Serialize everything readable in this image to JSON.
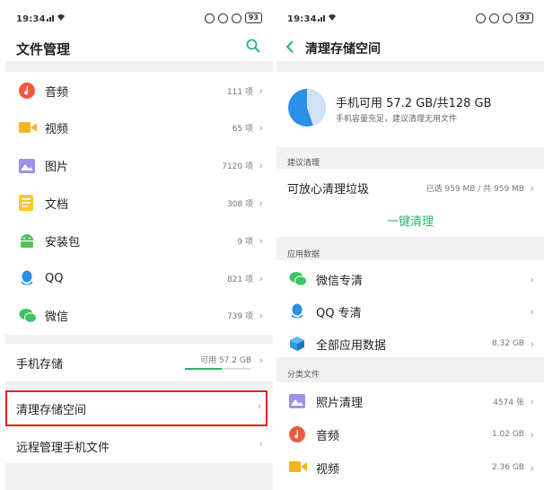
{
  "left": {
    "status_time": "19:34",
    "battery": "93",
    "title": "文件管理",
    "categories": [
      {
        "label": "音频",
        "count": "111 项",
        "color": "#f05a3c",
        "icon": "music-icon"
      },
      {
        "label": "视频",
        "count": "65 项",
        "color": "#f7b51c",
        "icon": "video-icon"
      },
      {
        "label": "图片",
        "count": "7120 项",
        "color": "#9f8fe8",
        "icon": "image-icon"
      },
      {
        "label": "文档",
        "count": "308 项",
        "color": "#f7c92e",
        "icon": "document-icon"
      },
      {
        "label": "安装包",
        "count": "9 项",
        "color": "#5bbf5b",
        "icon": "android-icon"
      },
      {
        "label": "QQ",
        "count": "821 项",
        "color": "#2c8fe8",
        "icon": "qq-icon"
      },
      {
        "label": "微信",
        "count": "739 项",
        "color": "#3cc464",
        "icon": "wechat-icon"
      }
    ],
    "storage": {
      "label": "手机存储",
      "available": "可用 57.2 GB",
      "used_fraction": 0.55
    },
    "clean_label": "清理存储空间",
    "remote_label": "远程管理手机文件"
  },
  "right": {
    "status_time": "19:34",
    "battery": "93",
    "title": "清理存储空间",
    "summary": {
      "headline": "手机可用 57.2 GB/共128 GB",
      "sub": "手机容量充足，建议清理无用文件",
      "available_fraction": 0.447
    },
    "suggest": {
      "section": "建议清理",
      "item_label": "可放心清理垃圾",
      "item_value": "已选 959 MB / 共 959 MB",
      "button": "一键清理"
    },
    "app_data": {
      "section": "应用数据",
      "items": [
        {
          "label": "微信专清",
          "value": "",
          "icon": "wechat-icon",
          "color": "#3cc464"
        },
        {
          "label": "QQ 专清",
          "value": "",
          "icon": "qq-icon",
          "color": "#2c8fe8"
        },
        {
          "label": "全部应用数据",
          "value": "8.32 GB",
          "icon": "cube-icon",
          "color": "#2c9de8"
        }
      ]
    },
    "category_files": {
      "section": "分类文件",
      "items": [
        {
          "label": "照片清理",
          "value": "4574 张",
          "icon": "image-icon",
          "color": "#9f8fe8"
        },
        {
          "label": "音频",
          "value": "1.02 GB",
          "icon": "music-icon",
          "color": "#f05a3c"
        },
        {
          "label": "视频",
          "value": "2.36 GB",
          "icon": "video-icon",
          "color": "#f7b51c"
        }
      ]
    }
  },
  "accent": "#2db36b",
  "highlight": "#e02020"
}
